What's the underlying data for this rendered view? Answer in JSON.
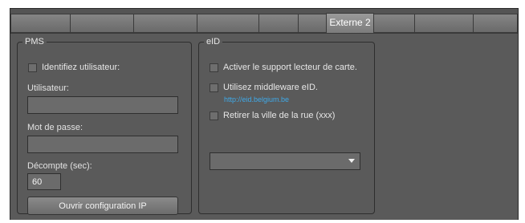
{
  "tabs": [
    {
      "label": ""
    },
    {
      "label": ""
    },
    {
      "label": ""
    },
    {
      "label": ""
    },
    {
      "label": ""
    },
    {
      "label": ""
    },
    {
      "label": "Externe 2"
    },
    {
      "label": ""
    },
    {
      "label": ""
    },
    {
      "label": ""
    },
    {
      "label": ""
    }
  ],
  "pms": {
    "legend": "PMS",
    "identify_label": "Identifiez utilisateur:",
    "user_label": "Utilisateur:",
    "user_value": "",
    "password_label": "Mot de passe:",
    "password_value": "",
    "countdown_label": "Décompte (sec):",
    "countdown_value": "60",
    "config_button": "Ouvrir configuration IP"
  },
  "eid": {
    "legend": "eID",
    "card_reader_label": "Activer le support lecteur de carte.",
    "middleware_label": "Utilisez middleware eID.",
    "middleware_link": "http://eid.belgium.be",
    "remove_city_label": "Retirer la ville de la rue (xxx)",
    "dropdown_value": ""
  },
  "colors": {
    "panel": "#5a5a5a",
    "link": "#3fa9e8"
  }
}
